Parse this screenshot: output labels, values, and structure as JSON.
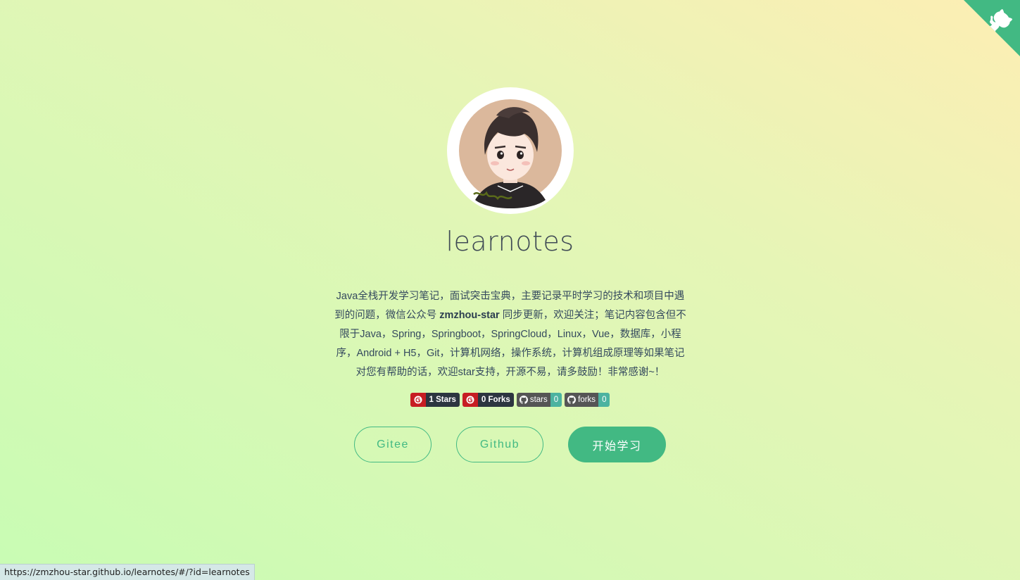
{
  "corner": {
    "icon": "github-cat-icon",
    "color": "#42b983"
  },
  "avatar": {
    "icon": "cartoon-avatar-icon"
  },
  "title": "learnotes",
  "description": {
    "part1": "Java全栈开发学习笔记，面试突击宝典，主要记录平时学习的技术和项目中遇到的问题，微信公众号 ",
    "highlight": "zmzhou-star",
    "part2": " 同步更新，欢迎关注；笔记内容包含但不限于Java，Spring，Springboot，SpringCloud，Linux，Vue，数据库，小程序，Android + H5，Git，计算机网络，操作系统，计算机组成原理等如果笔记对您有帮助的话，欢迎star支持，开源不易，请多鼓励！非常感谢~！"
  },
  "badges": {
    "gitee_stars": "1 Stars",
    "gitee_forks": "0 Forks",
    "gh_stars_label": "stars",
    "gh_stars_value": "0",
    "gh_forks_label": "forks",
    "gh_forks_value": "0"
  },
  "buttons": {
    "gitee": "Gitee",
    "github": "Github",
    "start": "开始学习"
  },
  "status_url": "https://zmzhou-star.github.io/learnotes/#/?id=learnotes",
  "colors": {
    "accent": "#42b983",
    "gitee_red": "#c71d23"
  }
}
